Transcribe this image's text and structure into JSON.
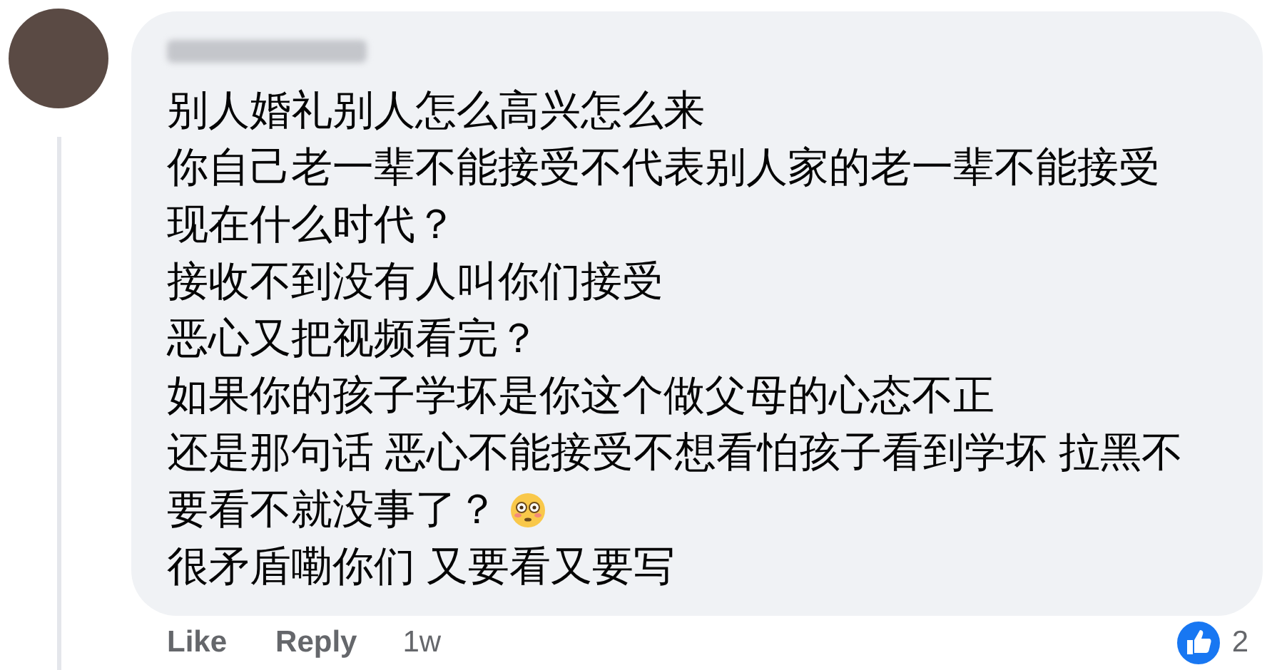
{
  "comment": {
    "lines": [
      "别人婚礼别人怎么高兴怎么来",
      "你自己老一辈不能接受不代表别人家的老一辈不能接受",
      "现在什么时代？",
      "接收不到没有人叫你们接受",
      "恶心又把视频看完？",
      "如果你的孩子学坏是你这个做父母的心态不正",
      "还是那句话 恶心不能接受不想看怕孩子看到学坏 拉黑不",
      "要看不就没事了？",
      "很矛盾嘞你们 又要看又要写"
    ]
  },
  "actions": [
    "Like",
    "Reply"
  ],
  "time": "1w",
  "reactions": {
    "count": "2"
  }
}
